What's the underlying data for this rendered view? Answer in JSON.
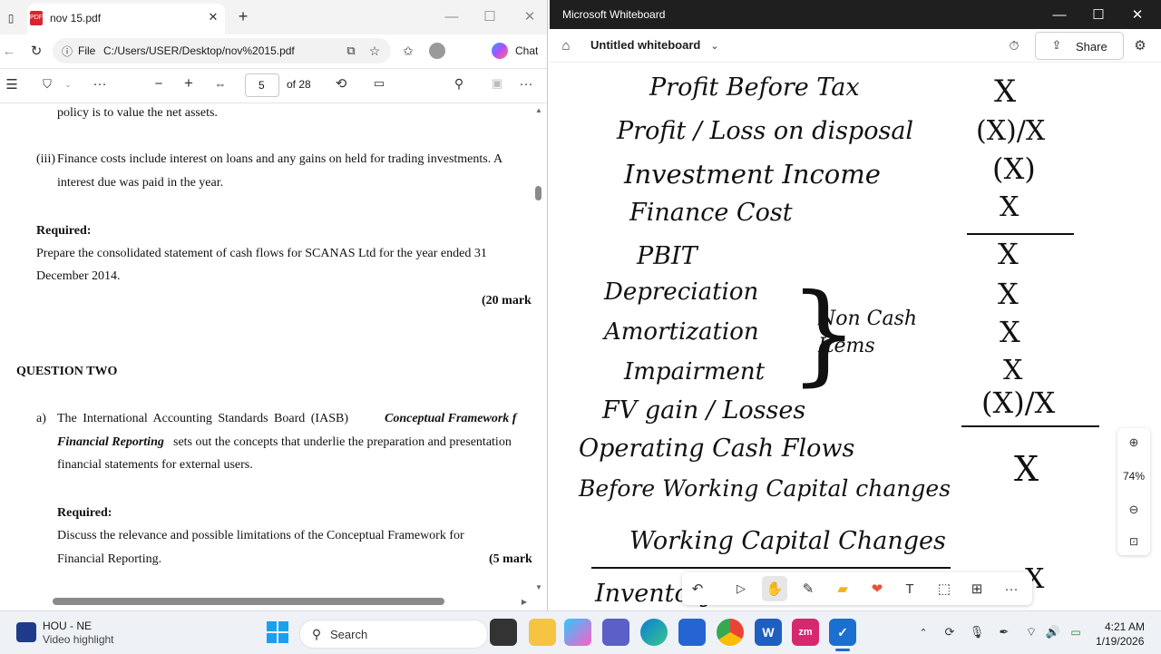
{
  "pdf": {
    "tab_title": "nov 15.pdf",
    "file_label": "File",
    "address": "C:/Users/USER/Desktop/nov%2015.pdf",
    "chat_label": "Chat",
    "page_current": "5",
    "page_total": "of 28",
    "body": {
      "line_policy": "policy is to value the net assets.",
      "item_iii_num": "(iii)",
      "item_iii_line1": "Finance costs include interest on loans and any gains on held for trading investments. A",
      "item_iii_line2": "interest due was paid in the year.",
      "required1": "Required:",
      "req1_line1": "Prepare the consolidated statement of cash flows for SCANAS Ltd for the year ended 31",
      "req1_line2": "December 2014.",
      "marks1": "(20 mark",
      "q2_heading": "QUESTION TWO",
      "a_label": "a)",
      "a_line1_pre": "The International Accounting Standards Board (IASB)",
      "a_line1_italic": "Conceptual Framework f",
      "a_line2_italic": "Financial Reporting",
      "a_line2_rest": "sets out the concepts that underlie the preparation and presentation",
      "a_line3": "financial statements for external users.",
      "required2": "Required:",
      "req2_line1": "Discuss the relevance and possible limitations of the Conceptual Framework for",
      "req2_line2": "Financial Reporting.",
      "marks2": "(5 mark"
    }
  },
  "whiteboard": {
    "app_title": "Microsoft Whiteboard",
    "board_name": "Untitled whiteboard",
    "share_label": "Share",
    "zoom": "74%",
    "left_items": [
      "Profit Before Tax",
      "Profit / Loss on disposal",
      "Investment Income",
      "Finance Cost",
      "PBIT",
      "Depreciation",
      "Amortization",
      "Impairment",
      "FV gain / Losses",
      "Operating Cash Flows",
      "Before Working Capital changes",
      "Working Capital Changes",
      "Inventory"
    ],
    "brace_note": "Non Cash Items",
    "right_items": [
      "X",
      "(X)/X",
      "(X)",
      "X",
      "X",
      "X",
      "X",
      "X",
      "(X)/X",
      "X",
      "X"
    ]
  },
  "taskbar": {
    "news_title": "HOU - NE",
    "news_sub": "Video highlight",
    "search_label": "Search",
    "time": "4:21 AM",
    "date": "1/19/2026"
  }
}
